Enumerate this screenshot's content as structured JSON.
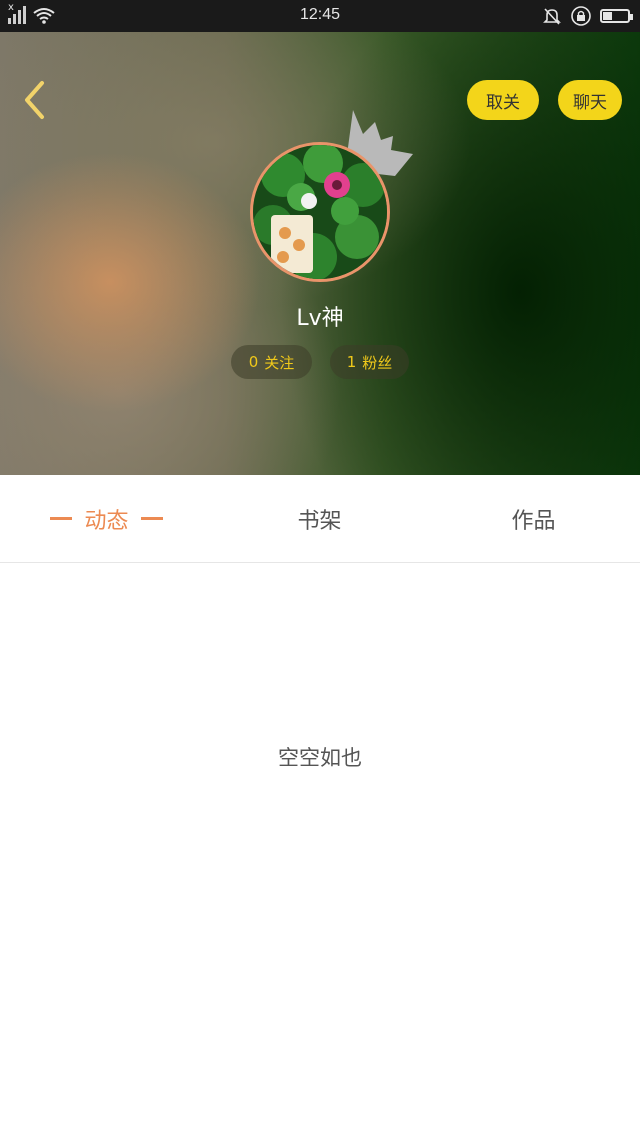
{
  "status_bar": {
    "time": "12:45",
    "icons": [
      "signal-icon",
      "wifi-icon",
      "bell-muted-icon",
      "lock-rotation-icon",
      "battery-icon"
    ]
  },
  "header": {
    "back_icon": "chevron-left-icon",
    "unfollow_label": "取关",
    "chat_label": "聊天"
  },
  "profile": {
    "username": "Lv神",
    "following": {
      "count": "0",
      "label": "关注"
    },
    "fans": {
      "count": "1",
      "label": "粉丝"
    }
  },
  "tabs": [
    {
      "label": "动态",
      "active": true
    },
    {
      "label": "书架",
      "active": false
    },
    {
      "label": "作品",
      "active": false
    }
  ],
  "content": {
    "empty_text": "空空如也"
  },
  "colors": {
    "accent": "#ec8a52",
    "button_yellow": "#f3d51a",
    "stat_text": "#f0c91a"
  }
}
